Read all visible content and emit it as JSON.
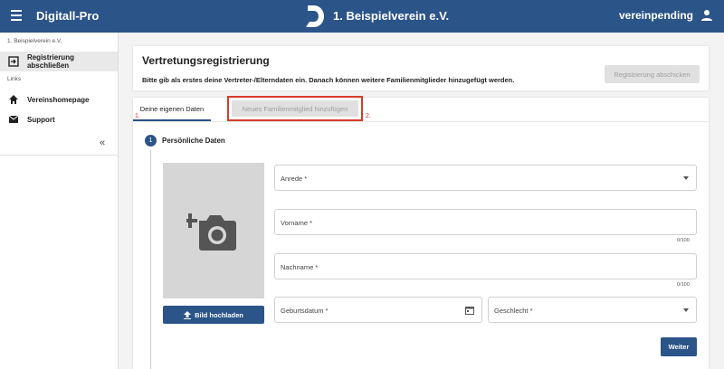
{
  "header": {
    "app_title": "Digitall-Pro",
    "club_name": "1. Beispielverein e.V.",
    "username": "vereinpending",
    "brand_color": "#2b5489"
  },
  "sidebar": {
    "section_club": "1. Beispielverein e.V.",
    "item_register": "Registrierung abschließen",
    "section_links": "Links",
    "item_homepage": "Vereinshomepage",
    "item_support": "Support"
  },
  "main": {
    "title": "Vertretungsregistrierung",
    "subtitle": "Bitte gib als erstes deine Vertreter-/Elterndaten ein. Danach können weitere Familienmitglieder hinzugefügt werden.",
    "complete_button": "Registrierung abschicken"
  },
  "tabs": {
    "own_data": "Deine eigenen Daten",
    "own_data_num": "1.",
    "add_member": "Neues Familienmitglied hinzufügen",
    "add_member_num": "2.",
    "highlight_color": "#d93b2b"
  },
  "step": {
    "number": "1",
    "label": "Persönliche Daten"
  },
  "form": {
    "upload_button": "Bild hochladen",
    "anrede": "Anrede *",
    "vorname": "Vorname *",
    "vorname_counter": "0/100",
    "nachname": "Nachname *",
    "nachname_counter": "0/100",
    "geburtsdatum": "Geburtsdatum *",
    "geschlecht": "Geschlecht *",
    "next_button": "Weiter"
  }
}
